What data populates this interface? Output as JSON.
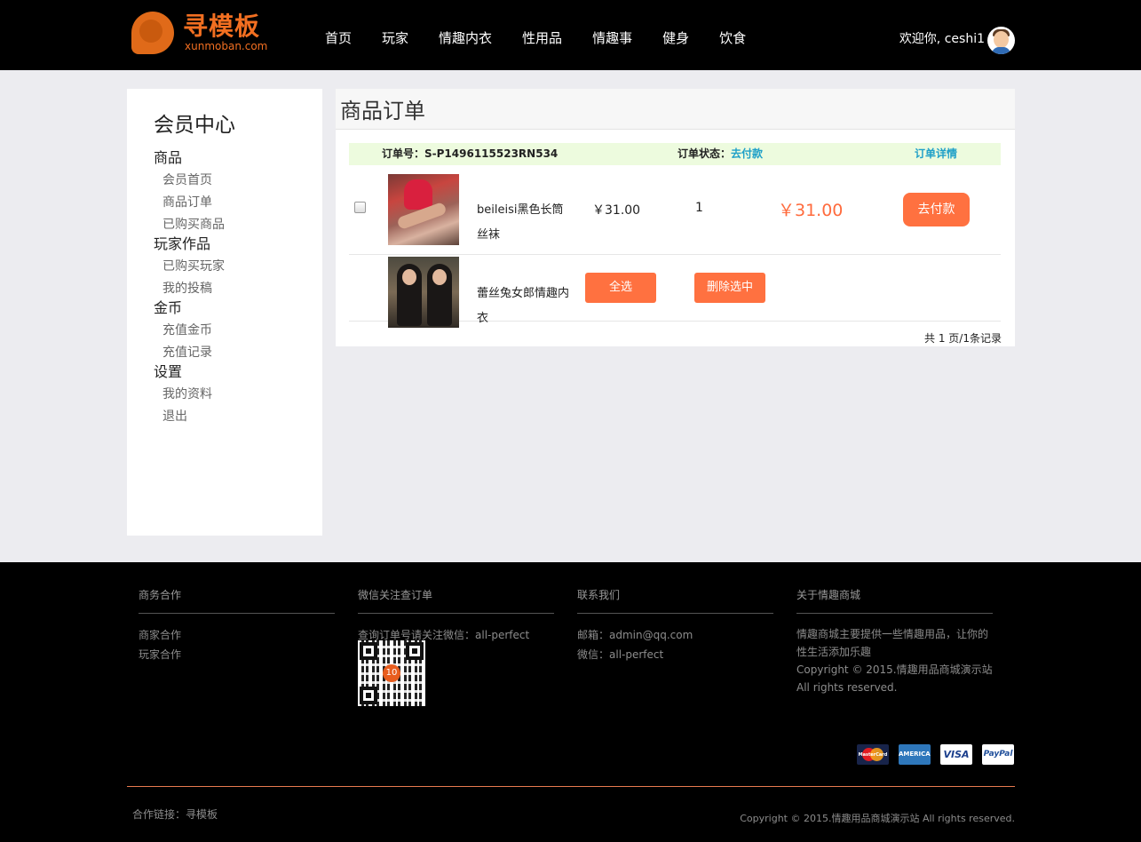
{
  "header": {
    "logo_cn": "寻模板",
    "logo_en": "xunmoban.com",
    "nav": [
      "首页",
      "玩家",
      "情趣内衣",
      "性用品",
      "情趣事",
      "健身",
      "饮食"
    ],
    "welcome": "欢迎你, ceshi1"
  },
  "sidebar": {
    "title": "会员中心",
    "groups": [
      {
        "label": "商品",
        "items": [
          "会员首页",
          "商品订单",
          "已购买商品"
        ]
      },
      {
        "label": "玩家作品",
        "items": [
          "已购买玩家",
          "我的投稿"
        ]
      },
      {
        "label": "金币",
        "items": [
          "充值金币",
          "充值记录"
        ]
      },
      {
        "label": "设置",
        "items": [
          "我的资料",
          "退出"
        ]
      }
    ]
  },
  "main": {
    "title": "商品订单",
    "order": {
      "no_label": "订单号：",
      "no": "S-P1496115523RN534",
      "status_label": "订单状态：",
      "status": "去付款",
      "detail_link": "订单详情"
    },
    "items": [
      {
        "name": "beileisi黑色长筒丝袜",
        "price": "￥31.00",
        "qty": "1",
        "total": "￥31.00",
        "action": "去付款"
      },
      {
        "name": "蕾丝兔女郎情趣内衣"
      }
    ],
    "select_all": "全选",
    "delete_selected": "删除选中",
    "pager": "共 1 页/1条记录"
  },
  "footer": {
    "cols": [
      {
        "title": "商务合作",
        "lines": [
          "商家合作",
          "玩家合作"
        ]
      },
      {
        "title": "微信关注查订单",
        "lines": [
          "查询订单号请关注微信：all-perfect"
        ]
      },
      {
        "title": "联系我们",
        "lines": [
          "邮箱：admin@qq.com",
          "微信：all-perfect"
        ]
      },
      {
        "title": "关于情趣商城",
        "lines": [
          "情趣商城主要提供一些情趣用品，让你的性生活添加乐趣",
          "Copyright © 2015.情趣用品商城演示站 All rights reserved."
        ]
      }
    ],
    "qr_badge": "10",
    "payment_icons": [
      "mastercard-icon",
      "amex-icon",
      "visa-icon",
      "paypal-icon"
    ],
    "payment_labels": {
      "mc": "MasterCard",
      "amex": "AMERICAN EXPRESS",
      "visa": "VISA",
      "paypal": "PayPal"
    },
    "links": "合作链接：寻模板",
    "copyright": "Copyright © 2015.情趣用品商城演示站 All rights reserved."
  },
  "colors": {
    "accent": "#ff7140",
    "link": "#1fa0c8",
    "order_head_bg": "#edfbde",
    "header_bg": "#000000"
  }
}
